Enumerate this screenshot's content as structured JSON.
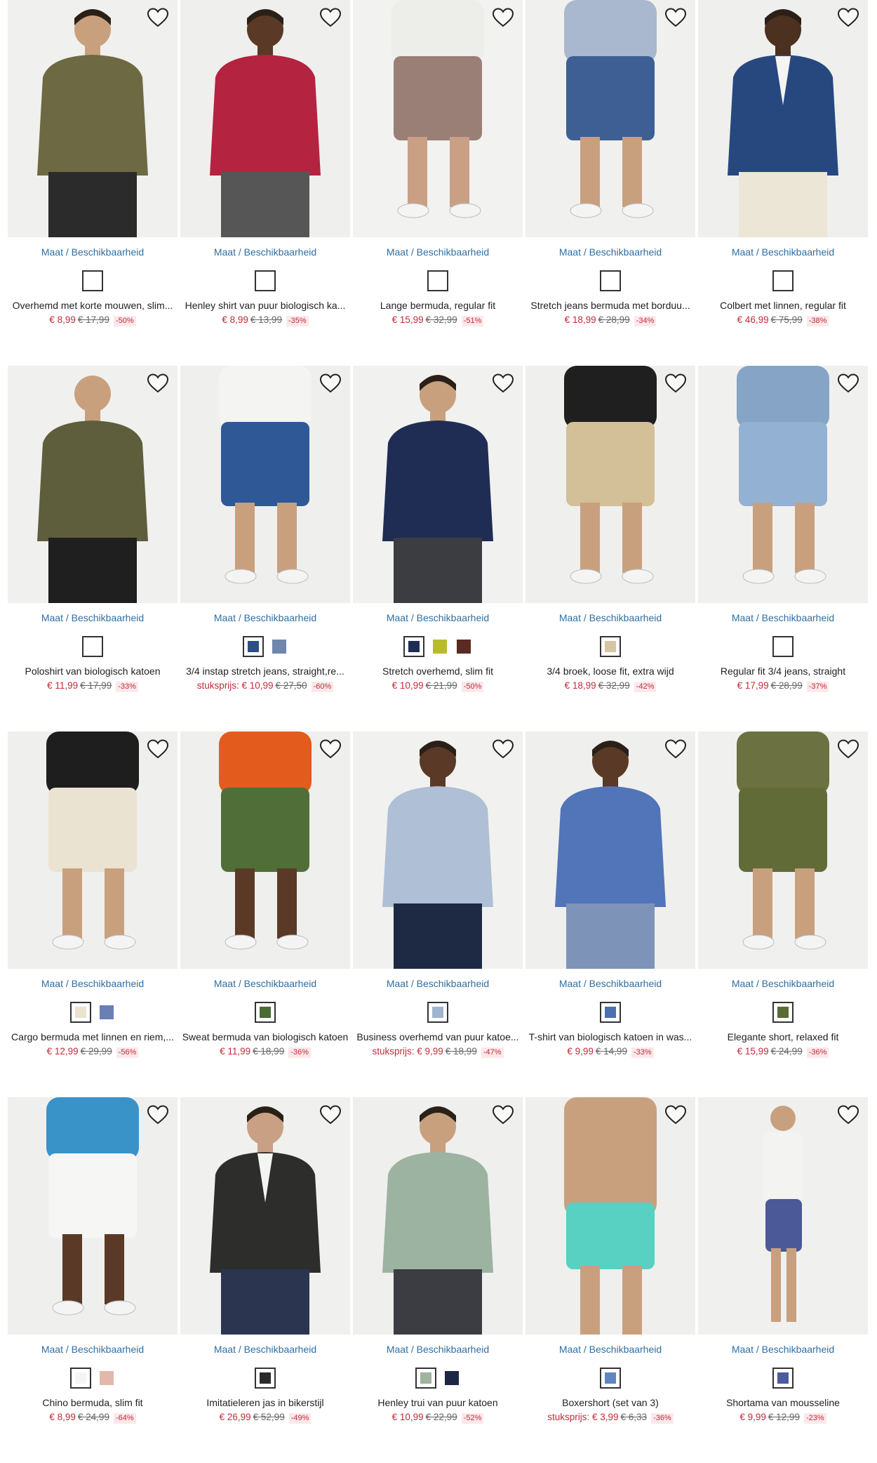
{
  "common": {
    "size_link": "Maat / Beschikbaarheid"
  },
  "products": [
    {
      "title": "Overhemd met korte mouwen, slim...",
      "prefix": "",
      "price": "€ 8,99",
      "old": "€ 17,99",
      "disc": "-50%",
      "swatches": [
        {
          "color": "#ffffff",
          "sel": true
        }
      ],
      "bg": "#f0f0ee",
      "top": "#6d6a43",
      "bottom": "#2b2b2b",
      "skin": "#c9a07e",
      "pose": "shirt"
    },
    {
      "title": "Henley shirt van puur biologisch ka...",
      "prefix": "",
      "price": "€ 8,99",
      "old": "€ 13,99",
      "disc": "-35%",
      "swatches": [
        {
          "color": "#ffffff",
          "sel": true
        }
      ],
      "bg": "#efefed",
      "top": "#b4233f",
      "bottom": "#565656",
      "skin": "#5a3a26",
      "pose": "shirt"
    },
    {
      "title": "Lange bermuda, regular fit",
      "prefix": "",
      "price": "€ 15,99",
      "old": "€ 32,99",
      "disc": "-51%",
      "swatches": [
        {
          "color": "#ffffff",
          "sel": true
        }
      ],
      "bg": "#f2f2f0",
      "top": "#ededea",
      "bottom": "#9a7f76",
      "skin": "#caa085",
      "pose": "shorts"
    },
    {
      "title": "Stretch jeans bermuda met borduu...",
      "prefix": "",
      "price": "€ 18,99",
      "old": "€ 28,99",
      "disc": "-34%",
      "swatches": [
        {
          "color": "#ffffff",
          "sel": true
        }
      ],
      "bg": "#f0f0ee",
      "top": "#a9b8cf",
      "bottom": "#3e5f93",
      "skin": "#c9a07e",
      "pose": "shorts"
    },
    {
      "title": "Colbert met linnen, regular fit",
      "prefix": "",
      "price": "€ 46,99",
      "old": "€ 75,99",
      "disc": "-38%",
      "swatches": [
        {
          "color": "#ffffff",
          "sel": true
        }
      ],
      "bg": "#efefed",
      "top": "#27487f",
      "bottom": "#ece6d6",
      "skin": "#4c3020",
      "pose": "jacket"
    },
    {
      "title": "Poloshirt van biologisch katoen",
      "prefix": "",
      "price": "€ 11,99",
      "old": "€ 17,99",
      "disc": "-33%",
      "swatches": [
        {
          "color": "#ffffff",
          "sel": true
        }
      ],
      "bg": "#f0f0ee",
      "top": "#5f5e3c",
      "bottom": "#1f1f1f",
      "skin": "#c9a07e",
      "pose": "back"
    },
    {
      "title": "3/4 instap stretch jeans, straight,re...",
      "prefix": "stuksprijs: ",
      "price": "€ 10,99",
      "old": "€ 27,50",
      "disc": "-60%",
      "swatches": [
        {
          "color": "#2d4f86",
          "sel": true
        },
        {
          "color": "#6f87ad",
          "sel": false
        }
      ],
      "bg": "#efefed",
      "top": "#f4f4f2",
      "bottom": "#2f5896",
      "skin": "#c9a07e",
      "pose": "shorts"
    },
    {
      "title": "Stretch overhemd, slim fit",
      "prefix": "",
      "price": "€ 10,99",
      "old": "€ 21,99",
      "disc": "-50%",
      "swatches": [
        {
          "color": "#1f2e55",
          "sel": true
        },
        {
          "color": "#b8bc2c",
          "sel": false
        },
        {
          "color": "#5b2a22",
          "sel": false
        }
      ],
      "bg": "#f1f1ef",
      "top": "#1f2d55",
      "bottom": "#3b3d41",
      "skin": "#c9a07e",
      "pose": "shirt"
    },
    {
      "title": "3/4 broek, loose fit, extra wijd",
      "prefix": "",
      "price": "€ 18,99",
      "old": "€ 32,99",
      "disc": "-42%",
      "swatches": [
        {
          "color": "#d7c5a2",
          "sel": true
        }
      ],
      "bg": "#efefed",
      "top": "#1f1f1f",
      "bottom": "#d3bf98",
      "skin": "#c9a07e",
      "pose": "shorts"
    },
    {
      "title": "Regular fit 3/4 jeans, straight",
      "prefix": "",
      "price": "€ 17,99",
      "old": "€ 28,99",
      "disc": "-37%",
      "swatches": [
        {
          "color": "#ffffff",
          "sel": true
        }
      ],
      "bg": "#f0f0ee",
      "top": "#86a4c6",
      "bottom": "#93b2d3",
      "skin": "#c9a07e",
      "pose": "shorts"
    },
    {
      "title": "Cargo bermuda met linnen en riem,...",
      "prefix": "",
      "price": "€ 12,99",
      "old": "€ 29,99",
      "disc": "-56%",
      "swatches": [
        {
          "color": "#ebe2cf",
          "sel": true
        },
        {
          "color": "#6b7fb5",
          "sel": false
        }
      ],
      "bg": "#efefed",
      "top": "#1e1e1e",
      "bottom": "#ebe3d2",
      "skin": "#c9a07e",
      "pose": "shorts"
    },
    {
      "title": "Sweat bermuda van biologisch katoen",
      "prefix": "",
      "price": "€ 11,99",
      "old": "€ 18,99",
      "disc": "-36%",
      "swatches": [
        {
          "color": "#4b6b35",
          "sel": true
        }
      ],
      "bg": "#efefed",
      "top": "#e35b1d",
      "bottom": "#4f6e38",
      "skin": "#5a3a26",
      "pose": "shorts"
    },
    {
      "title": "Business overhemd van puur katoe...",
      "prefix": "stuksprijs: ",
      "price": "€ 9,99",
      "old": "€ 18,99",
      "disc": "-47%",
      "swatches": [
        {
          "color": "#9fb5cf",
          "sel": true
        }
      ],
      "bg": "#f1f1ef",
      "top": "#aebfd6",
      "bottom": "#1e2a44",
      "skin": "#5a3a26",
      "pose": "shirt"
    },
    {
      "title": "T-shirt van biologisch katoen in was...",
      "prefix": "",
      "price": "€ 9,99",
      "old": "€ 14,99",
      "disc": "-33%",
      "swatches": [
        {
          "color": "#4c6fb2",
          "sel": true
        }
      ],
      "bg": "#efefed",
      "top": "#5274b8",
      "bottom": "#7d94b8",
      "skin": "#5a3a26",
      "pose": "shirt"
    },
    {
      "title": "Elegante short, relaxed fit",
      "prefix": "",
      "price": "€ 15,99",
      "old": "€ 24,99",
      "disc": "-36%",
      "swatches": [
        {
          "color": "#5b6b34",
          "sel": true
        }
      ],
      "bg": "#f0f0ee",
      "top": "#6b7140",
      "bottom": "#616b37",
      "skin": "#c9a07e",
      "pose": "shorts"
    },
    {
      "title": "Chino bermuda, slim fit",
      "prefix": "",
      "price": "€ 8,99",
      "old": "€ 24,99",
      "disc": "-64%",
      "swatches": [
        {
          "color": "#f5f5f3",
          "sel": true
        },
        {
          "color": "#e2b8aa",
          "sel": false
        }
      ],
      "bg": "#efefed",
      "top": "#3a93c8",
      "bottom": "#f6f6f4",
      "skin": "#5a3a26",
      "pose": "shorts"
    },
    {
      "title": "Imitatieleren jas in bikerstijl",
      "prefix": "",
      "price": "€ 26,99",
      "old": "€ 52,99",
      "disc": "-49%",
      "swatches": [
        {
          "color": "#2b2b2b",
          "sel": true
        }
      ],
      "bg": "#f0f0ee",
      "top": "#2d2d2b",
      "bottom": "#2b3550",
      "skin": "#caa085",
      "pose": "jacket"
    },
    {
      "title": "Henley trui van puur katoen",
      "prefix": "",
      "price": "€ 10,99",
      "old": "€ 22,99",
      "disc": "-52%",
      "swatches": [
        {
          "color": "#9fb39f",
          "sel": true
        },
        {
          "color": "#1d2745",
          "sel": false
        }
      ],
      "bg": "#efefed",
      "top": "#9cb3a2",
      "bottom": "#3b3d42",
      "skin": "#c9a07e",
      "pose": "sweater"
    },
    {
      "title": "Boxershort (set van 3)",
      "prefix": "stuksprijs: ",
      "price": "€ 3,99",
      "old": "€ 6,33",
      "disc": "-36%",
      "swatches": [
        {
          "color": "#5f86bf",
          "sel": true
        }
      ],
      "bg": "#efefed",
      "top": "#c9a07e",
      "bottom": "#58d0c2",
      "skin": "#c9a07e",
      "pose": "boxer"
    },
    {
      "title": "Shortama van mousseline",
      "prefix": "",
      "price": "€ 9,99",
      "old": "€ 12,99",
      "disc": "-23%",
      "swatches": [
        {
          "color": "#4d5a9c",
          "sel": true
        }
      ],
      "bg": "#f0f0ee",
      "top": "#f3f3f1",
      "bottom": "#4c5998",
      "skin": "#c9a07e",
      "pose": "full"
    }
  ]
}
